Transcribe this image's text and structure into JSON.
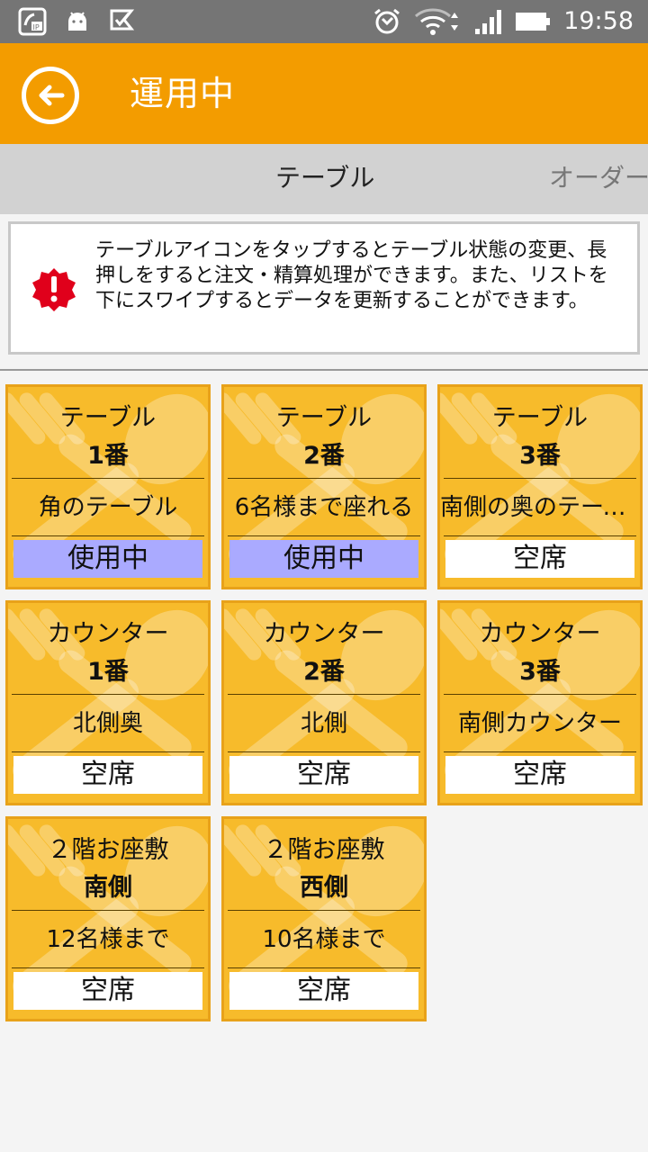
{
  "status_bar": {
    "time": "19:58",
    "left_icons": [
      "ip-phone-icon",
      "android-icon",
      "check-flag-icon"
    ],
    "right_icons": [
      "alarm-icon",
      "wifi-icon",
      "signal-icon",
      "battery-icon"
    ]
  },
  "app_bar": {
    "back_icon": "back-arrow-icon",
    "title": "運用中",
    "color": "#f39c00"
  },
  "tabs": {
    "active": "テーブル",
    "next": "オーダー"
  },
  "info": {
    "icon": "alert-badge-icon",
    "icon_color": "#e0001b",
    "text": "テーブルアイコンをタップするとテーブル状態の変更、長押しをすると注文・精算処理ができます。また、リストを下にスワイプするとデータを更新することができます。"
  },
  "colors": {
    "card_bg": "#f7bb2b",
    "card_border": "#e8a21a",
    "status_busy": "#aaaaff",
    "status_free": "#ffffff"
  },
  "tables": [
    {
      "name": "テーブル",
      "number": "1番",
      "note": "角のテーブル",
      "status": "使用中",
      "busy": true
    },
    {
      "name": "テーブル",
      "number": "2番",
      "note": "6名様まで座れる",
      "status": "使用中",
      "busy": true
    },
    {
      "name": "テーブル",
      "number": "3番",
      "note": "南側の奥のテーブル",
      "status": "空席",
      "busy": false
    },
    {
      "name": "カウンター",
      "number": "1番",
      "note": "北側奥",
      "status": "空席",
      "busy": false
    },
    {
      "name": "カウンター",
      "number": "2番",
      "note": "北側",
      "status": "空席",
      "busy": false
    },
    {
      "name": "カウンター",
      "number": "3番",
      "note": "南側カウンター",
      "status": "空席",
      "busy": false
    },
    {
      "name": "２階お座敷",
      "number": "南側",
      "note": "12名様まで",
      "status": "空席",
      "busy": false
    },
    {
      "name": "２階お座敷",
      "number": "西側",
      "note": "10名様まで",
      "status": "空席",
      "busy": false
    }
  ]
}
